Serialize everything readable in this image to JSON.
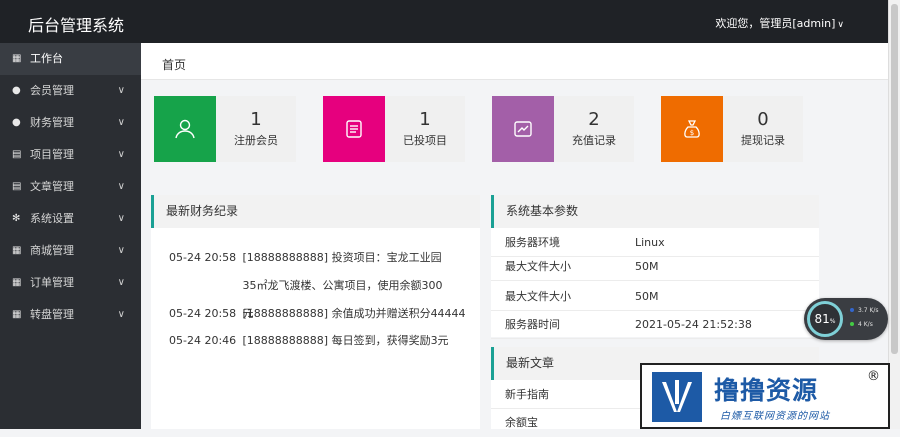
{
  "header": {
    "title": "后台管理系统",
    "welcome": "欢迎您，管理员[admin]"
  },
  "sidebar": {
    "items": [
      {
        "label": "工作台"
      },
      {
        "label": "会员管理"
      },
      {
        "label": "财务管理"
      },
      {
        "label": "项目管理"
      },
      {
        "label": "文章管理"
      },
      {
        "label": "系统设置"
      },
      {
        "label": "商城管理"
      },
      {
        "label": "订单管理"
      },
      {
        "label": "转盘管理"
      }
    ]
  },
  "breadcrumb": {
    "home": "首页"
  },
  "stats": [
    {
      "value": "1",
      "label": "注册会员",
      "color": "#16a34a"
    },
    {
      "value": "1",
      "label": "已投项目",
      "color": "#e6007e"
    },
    {
      "value": "2",
      "label": "充值记录",
      "color": "#a35fa8"
    },
    {
      "value": "0",
      "label": "提现记录",
      "color": "#ef6c00"
    }
  ],
  "finance": {
    "title": "最新财务纪录",
    "records": [
      {
        "time": "05-24 20:58",
        "text": "[18888888888] 投资项目：宝龙工业园35㎡龙飞渡楼、公寓项目，使用余额300元"
      },
      {
        "time": "05-24 20:58",
        "text": "[18888888888] 余值成功并赠送积分44444"
      },
      {
        "time": "05-24 20:46",
        "text": "[18888888888] 每日签到，获得奖励3元"
      }
    ]
  },
  "system": {
    "title": "系统基本参数",
    "rows": [
      {
        "key": "服务器环境",
        "value": "Linux"
      },
      {
        "key": "最大文件大小",
        "value": "50M"
      },
      {
        "key": "最大文件大小",
        "value": "50M"
      },
      {
        "key": "服务器时间",
        "value": "2021-05-24 21:52:38"
      }
    ]
  },
  "articles": {
    "title": "最新文章",
    "items": [
      {
        "title": "新手指南"
      },
      {
        "title": "余额宝"
      }
    ]
  },
  "net_widget": {
    "percent": "81",
    "unit": "%",
    "up": "3.7",
    "up_unit": "K/s",
    "down": "4",
    "down_unit": "K/s"
  },
  "watermark": {
    "text": "撸撸资源",
    "mark": "®",
    "sub": "白嫖互联网资源的网站"
  },
  "colors": {
    "accent": "#1aa094",
    "topbar": "#1f2226",
    "sidebar": "#2b2e33"
  }
}
